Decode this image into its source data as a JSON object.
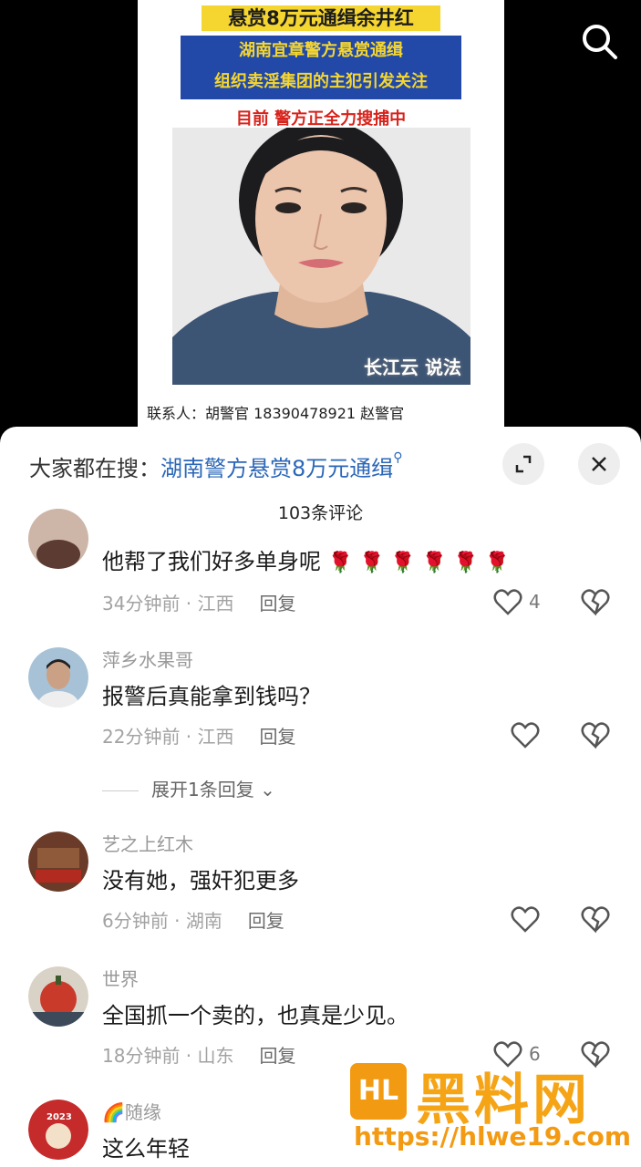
{
  "video": {
    "poster_title": "悬赏8万元通缉余井红",
    "poster_sub_line1": "湖南宜章警方悬赏通缉",
    "poster_sub_line2": "组织卖淫集团的主犯引发关注",
    "poster_status": "目前 警方正全力搜捕中",
    "watermark": "长江云 说法",
    "contact": "联系人：胡警官 18390478921 赵警官",
    "search_icon": "search-icon"
  },
  "sheet": {
    "hot_search_label": "大家都在搜：",
    "hot_search_keyword": "湖南警方悬赏8万元通缉",
    "hot_search_icon": "magnifier-icon",
    "expand_icon": "expand-icon",
    "close_icon": "close-icon",
    "comment_count": "103条评论"
  },
  "comments": [
    {
      "name": "",
      "text": "他帮了我们好多单身呢",
      "emoji": "🌹 🌹 🌹 🌹 🌹 🌹",
      "time": "34分钟前",
      "location": "江西",
      "reply": "回复",
      "likes": "4"
    },
    {
      "name": "萍乡水果哥",
      "text": "报警后真能拿到钱吗？",
      "time": "22分钟前",
      "location": "江西",
      "reply": "回复",
      "likes": ""
    },
    {
      "name": "艺之上红木",
      "text": "没有她，强奸犯更多",
      "time": "6分钟前",
      "location": "湖南",
      "reply": "回复",
      "likes": ""
    },
    {
      "name": "世界",
      "text": "全国抓一个卖的，也真是少见。",
      "time": "18分钟前",
      "location": "山东",
      "reply": "回复",
      "likes": "6"
    },
    {
      "name": "🌈随缘",
      "text": "这么年轻",
      "time": "",
      "location": "",
      "reply": "",
      "likes": ""
    }
  ],
  "expand_replies": "展开1条回复",
  "avatar4_badge": "2023",
  "brand": {
    "logo": "HL",
    "name": "黑料网",
    "url": "https://hlwe19.com"
  },
  "colors": {
    "poster_yellow": "#f5d630",
    "poster_blue": "#2249a8",
    "poster_red": "#d8231c",
    "link_blue": "#2b67b8",
    "brand_orange": "#f5a416"
  }
}
